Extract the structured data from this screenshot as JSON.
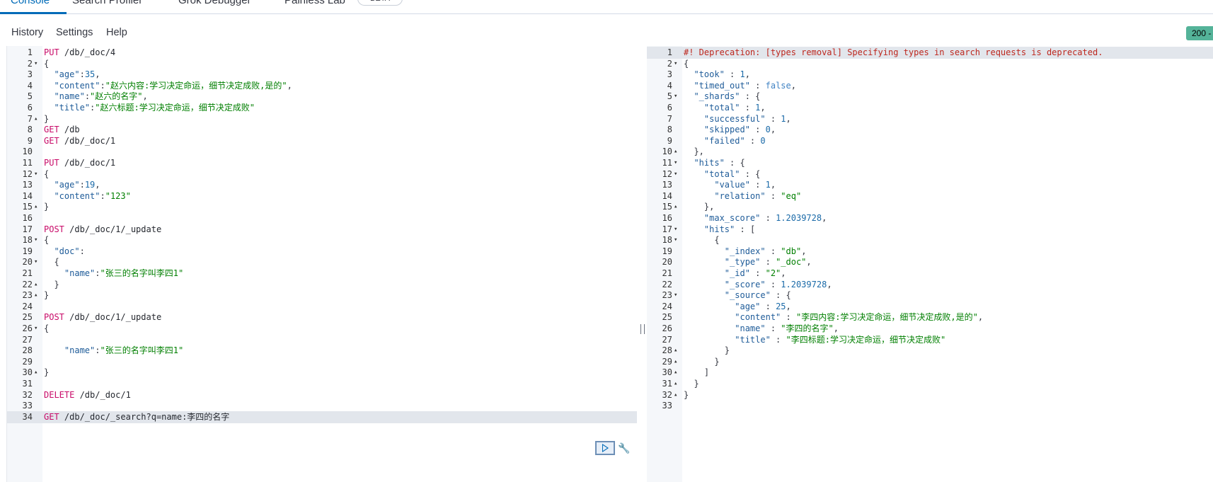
{
  "tabs": [
    "Console",
    "Search Profiler",
    "Grok Debugger",
    "Painless Lab"
  ],
  "beta_badge": "BETA",
  "menu": {
    "history": "History",
    "settings": "Settings",
    "help": "Help"
  },
  "status_badge": "200 -",
  "editor_lines": [
    [
      [
        "m",
        "PUT"
      ],
      [
        "u",
        " /db/_doc/4"
      ]
    ],
    [
      [
        "p",
        "{"
      ]
    ],
    [
      [
        "p",
        "  "
      ],
      [
        "k",
        "\"age\""
      ],
      [
        "p",
        ":"
      ],
      [
        "n",
        "35"
      ],
      [
        "p",
        ","
      ]
    ],
    [
      [
        "p",
        "  "
      ],
      [
        "k",
        "\"content\""
      ],
      [
        "p",
        ":"
      ],
      [
        "s",
        "\"赵六内容:学习决定命运，细节决定成败,是的\""
      ],
      [
        "p",
        ","
      ]
    ],
    [
      [
        "p",
        "  "
      ],
      [
        "k",
        "\"name\""
      ],
      [
        "p",
        ":"
      ],
      [
        "s",
        "\"赵六的名字\""
      ],
      [
        "p",
        ","
      ]
    ],
    [
      [
        "p",
        "  "
      ],
      [
        "k",
        "\"title\""
      ],
      [
        "p",
        ":"
      ],
      [
        "s",
        "\"赵六标题:学习决定命运，细节决定成败\""
      ]
    ],
    [
      [
        "p",
        "}"
      ]
    ],
    [
      [
        "m",
        "GET"
      ],
      [
        "u",
        " /db"
      ]
    ],
    [
      [
        "m",
        "GET"
      ],
      [
        "u",
        " /db/_doc/1"
      ]
    ],
    [],
    [
      [
        "m",
        "PUT"
      ],
      [
        "u",
        " /db/_doc/1"
      ]
    ],
    [
      [
        "p",
        "{"
      ]
    ],
    [
      [
        "p",
        "  "
      ],
      [
        "k",
        "\"age\""
      ],
      [
        "p",
        ":"
      ],
      [
        "n",
        "19"
      ],
      [
        "p",
        ","
      ]
    ],
    [
      [
        "p",
        "  "
      ],
      [
        "k",
        "\"content\""
      ],
      [
        "p",
        ":"
      ],
      [
        "s",
        "\"123\""
      ]
    ],
    [
      [
        "p",
        "}"
      ]
    ],
    [],
    [
      [
        "m",
        "POST"
      ],
      [
        "u",
        " /db/_doc/1/_update"
      ]
    ],
    [
      [
        "p",
        "{"
      ]
    ],
    [
      [
        "p",
        "  "
      ],
      [
        "k",
        "\"doc\""
      ],
      [
        "p",
        ":"
      ]
    ],
    [
      [
        "p",
        "  {"
      ]
    ],
    [
      [
        "p",
        "    "
      ],
      [
        "k",
        "\"name\""
      ],
      [
        "p",
        ":"
      ],
      [
        "s",
        "\"张三的名字叫李四1\""
      ]
    ],
    [
      [
        "p",
        "  }"
      ]
    ],
    [
      [
        "p",
        "}"
      ]
    ],
    [],
    [
      [
        "m",
        "POST"
      ],
      [
        "u",
        " /db/_doc/1/_update"
      ]
    ],
    [
      [
        "p",
        "{"
      ]
    ],
    [],
    [
      [
        "p",
        "    "
      ],
      [
        "k",
        "\"name\""
      ],
      [
        "p",
        ":"
      ],
      [
        "s",
        "\"张三的名字叫李四1\""
      ]
    ],
    [],
    [
      [
        "p",
        "}"
      ]
    ],
    [],
    [
      [
        "m",
        "DELETE"
      ],
      [
        "u",
        " /db/_doc/1"
      ]
    ],
    [],
    [
      [
        "m",
        "GET"
      ],
      [
        "u",
        " /db/_doc/_search?q=name:李四的名字"
      ]
    ]
  ],
  "editor_folds": {
    "2": "▾",
    "7": "▴",
    "12": "▾",
    "15": "▴",
    "18": "▾",
    "20": "▾",
    "22": "▴",
    "23": "▴",
    "26": "▾",
    "30": "▴"
  },
  "editor_active_line": 34,
  "output_lines": [
    [
      [
        "w",
        "#! Deprecation: [types removal] Specifying types in search requests is deprecated."
      ]
    ],
    [
      [
        "p",
        "{"
      ]
    ],
    [
      [
        "p",
        "  "
      ],
      [
        "k",
        "\"took\""
      ],
      [
        "p",
        " : "
      ],
      [
        "n",
        "1"
      ],
      [
        "p",
        ","
      ]
    ],
    [
      [
        "p",
        "  "
      ],
      [
        "k",
        "\"timed_out\""
      ],
      [
        "p",
        " : "
      ],
      [
        "b",
        "false"
      ],
      [
        "p",
        ","
      ]
    ],
    [
      [
        "p",
        "  "
      ],
      [
        "k",
        "\"_shards\""
      ],
      [
        "p",
        " : {"
      ]
    ],
    [
      [
        "p",
        "    "
      ],
      [
        "k",
        "\"total\""
      ],
      [
        "p",
        " : "
      ],
      [
        "n",
        "1"
      ],
      [
        "p",
        ","
      ]
    ],
    [
      [
        "p",
        "    "
      ],
      [
        "k",
        "\"successful\""
      ],
      [
        "p",
        " : "
      ],
      [
        "n",
        "1"
      ],
      [
        "p",
        ","
      ]
    ],
    [
      [
        "p",
        "    "
      ],
      [
        "k",
        "\"skipped\""
      ],
      [
        "p",
        " : "
      ],
      [
        "n",
        "0"
      ],
      [
        "p",
        ","
      ]
    ],
    [
      [
        "p",
        "    "
      ],
      [
        "k",
        "\"failed\""
      ],
      [
        "p",
        " : "
      ],
      [
        "n",
        "0"
      ]
    ],
    [
      [
        "p",
        "  },"
      ]
    ],
    [
      [
        "p",
        "  "
      ],
      [
        "k",
        "\"hits\""
      ],
      [
        "p",
        " : {"
      ]
    ],
    [
      [
        "p",
        "    "
      ],
      [
        "k",
        "\"total\""
      ],
      [
        "p",
        " : {"
      ]
    ],
    [
      [
        "p",
        "      "
      ],
      [
        "k",
        "\"value\""
      ],
      [
        "p",
        " : "
      ],
      [
        "n",
        "1"
      ],
      [
        "p",
        ","
      ]
    ],
    [
      [
        "p",
        "      "
      ],
      [
        "k",
        "\"relation\""
      ],
      [
        "p",
        " : "
      ],
      [
        "s",
        "\"eq\""
      ]
    ],
    [
      [
        "p",
        "    },"
      ]
    ],
    [
      [
        "p",
        "    "
      ],
      [
        "k",
        "\"max_score\""
      ],
      [
        "p",
        " : "
      ],
      [
        "n",
        "1.2039728"
      ],
      [
        "p",
        ","
      ]
    ],
    [
      [
        "p",
        "    "
      ],
      [
        "k",
        "\"hits\""
      ],
      [
        "p",
        " : ["
      ]
    ],
    [
      [
        "p",
        "      {"
      ]
    ],
    [
      [
        "p",
        "        "
      ],
      [
        "k",
        "\"_index\""
      ],
      [
        "p",
        " : "
      ],
      [
        "s",
        "\"db\""
      ],
      [
        "p",
        ","
      ]
    ],
    [
      [
        "p",
        "        "
      ],
      [
        "k",
        "\"_type\""
      ],
      [
        "p",
        " : "
      ],
      [
        "s",
        "\"_doc\""
      ],
      [
        "p",
        ","
      ]
    ],
    [
      [
        "p",
        "        "
      ],
      [
        "k",
        "\"_id\""
      ],
      [
        "p",
        " : "
      ],
      [
        "s",
        "\"2\""
      ],
      [
        "p",
        ","
      ]
    ],
    [
      [
        "p",
        "        "
      ],
      [
        "k",
        "\"_score\""
      ],
      [
        "p",
        " : "
      ],
      [
        "n",
        "1.2039728"
      ],
      [
        "p",
        ","
      ]
    ],
    [
      [
        "p",
        "        "
      ],
      [
        "k",
        "\"_source\""
      ],
      [
        "p",
        " : {"
      ]
    ],
    [
      [
        "p",
        "          "
      ],
      [
        "k",
        "\"age\""
      ],
      [
        "p",
        " : "
      ],
      [
        "n",
        "25"
      ],
      [
        "p",
        ","
      ]
    ],
    [
      [
        "p",
        "          "
      ],
      [
        "k",
        "\"content\""
      ],
      [
        "p",
        " : "
      ],
      [
        "s",
        "\"李四内容:学习决定命运，细节决定成败,是的\""
      ],
      [
        "p",
        ","
      ]
    ],
    [
      [
        "p",
        "          "
      ],
      [
        "k",
        "\"name\""
      ],
      [
        "p",
        " : "
      ],
      [
        "s",
        "\"李四的名字\""
      ],
      [
        "p",
        ","
      ]
    ],
    [
      [
        "p",
        "          "
      ],
      [
        "k",
        "\"title\""
      ],
      [
        "p",
        " : "
      ],
      [
        "s",
        "\"李四标题:学习决定命运，细节决定成败\""
      ]
    ],
    [
      [
        "p",
        "        }"
      ]
    ],
    [
      [
        "p",
        "      }"
      ]
    ],
    [
      [
        "p",
        "    ]"
      ]
    ],
    [
      [
        "p",
        "  }"
      ]
    ],
    [
      [
        "p",
        "}"
      ]
    ],
    []
  ],
  "output_folds": {
    "2": "▾",
    "5": "▾",
    "10": "▴",
    "11": "▾",
    "12": "▾",
    "15": "▴",
    "17": "▾",
    "18": "▾",
    "23": "▾",
    "28": "▴",
    "29": "▴",
    "30": "▴",
    "31": "▴",
    "32": "▴"
  },
  "output_active_line": 1,
  "icons": {
    "run": "play-icon",
    "tools": "wrench-icon",
    "resize": "resize-handle-icon"
  },
  "colors": {
    "accent": "#006bb8",
    "status_ok": "#54b399",
    "method": "#c80a68",
    "string": "#007f00",
    "warning": "#bd271e"
  }
}
